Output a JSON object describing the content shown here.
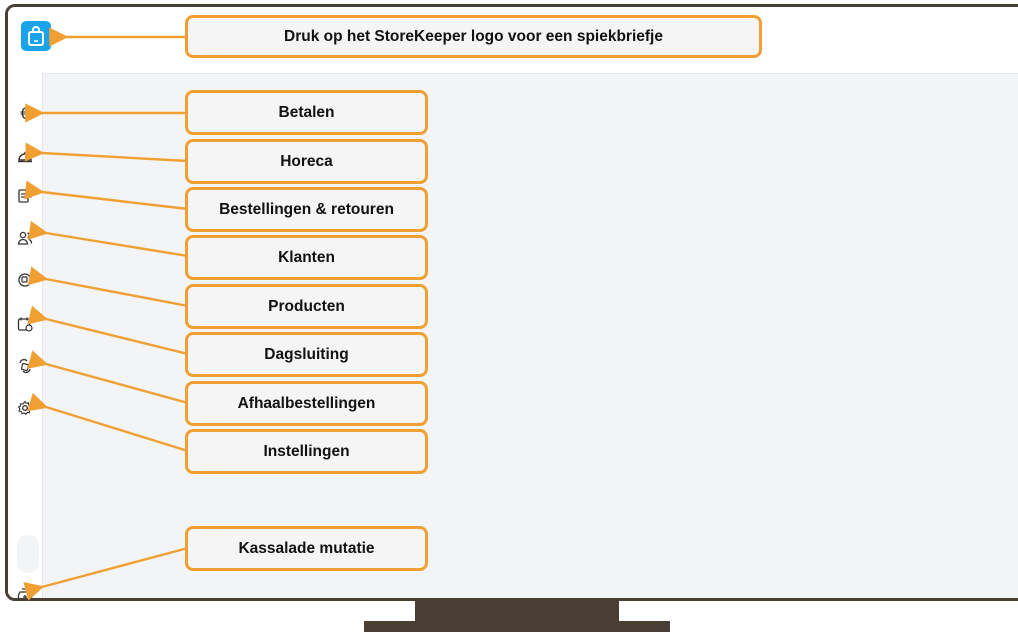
{
  "callouts": {
    "logo_hint": "Druk op het StoreKeeper logo voor een spiekbriefje",
    "betalen": "Betalen",
    "horeca": "Horeca",
    "bestellingen": "Bestellingen & retouren",
    "klanten": "Klanten",
    "producten": "Producten",
    "dagsluiting": "Dagsluiting",
    "afhaal": "Afhaalbestellingen",
    "instellingen": "Instellingen",
    "kassalade": "Kassalade mutatie"
  },
  "icons": {
    "logo": "shopping-bag-icon",
    "betalen": "euro-icon",
    "horeca": "service-bell-icon",
    "bestellingen": "receipt-icon",
    "klanten": "users-icon",
    "producten": "product-box-icon",
    "dagsluiting": "calendar-clock-icon",
    "afhaal": "pickup-icon",
    "instellingen": "gear-icon",
    "kassalade": "cash-drawer-icon"
  },
  "colors": {
    "accent": "#f0a033",
    "logo": "#1aa3e8",
    "frame": "#4a3f35"
  }
}
